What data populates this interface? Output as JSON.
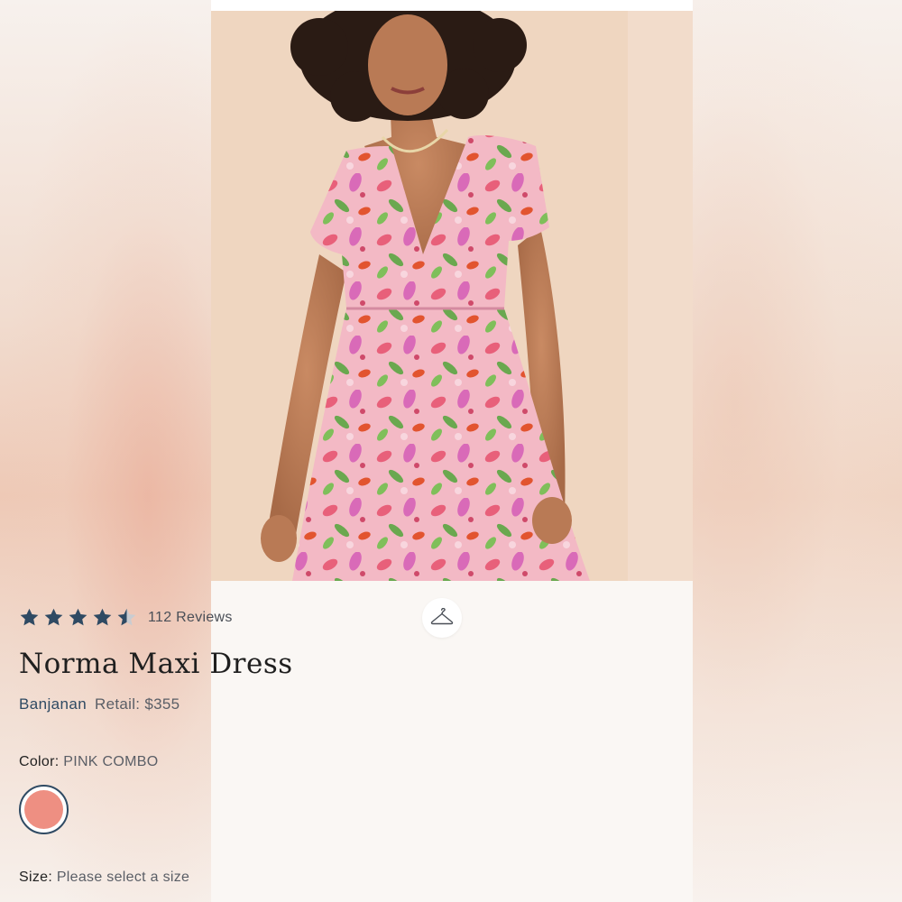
{
  "product": {
    "rating": 4.5,
    "max_rating": 5,
    "reviews_label": "112 Reviews",
    "name": "Norma Maxi Dress",
    "brand": "Banjanan",
    "retail": "Retail: $355"
  },
  "color": {
    "label": "Color:",
    "value": "PINK COMBO",
    "swatch_hex": "#ee8f82"
  },
  "size": {
    "label": "Size:",
    "value": "Please select a size"
  },
  "icons": {
    "star": "star-icon",
    "hanger": "hanger-icon"
  },
  "colors": {
    "star_fill": "#2f4a63",
    "accent": "#2f4a63"
  }
}
